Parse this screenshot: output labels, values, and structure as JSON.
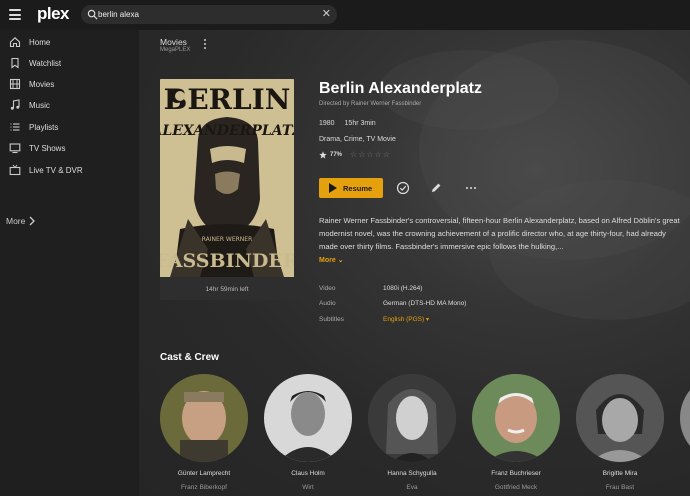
{
  "app": {
    "logo_text": "plex",
    "brand_color": "#e5a00d"
  },
  "search": {
    "value": "berlin alexa",
    "placeholder": "Search"
  },
  "sidebar": {
    "items": [
      {
        "label": "Home",
        "icon": "home-icon"
      },
      {
        "label": "Watchlist",
        "icon": "bookmark-icon"
      },
      {
        "label": "Movies",
        "icon": "film-icon"
      },
      {
        "label": "Music",
        "icon": "music-icon"
      },
      {
        "label": "Playlists",
        "icon": "list-icon"
      },
      {
        "label": "TV Shows",
        "icon": "tv-icon"
      },
      {
        "label": "Live TV & DVR",
        "icon": "broadcast-icon"
      }
    ],
    "more_label": "More"
  },
  "breadcrumb": {
    "title": "Movies",
    "subtitle": "MegaPLEX"
  },
  "movie": {
    "title": "Berlin Alexanderplatz",
    "director": "Directed by Rainer Werner Fassbinder",
    "year": "1980",
    "duration": "15hr 3min",
    "genres": "Drama, Crime, TV Movie",
    "rating_pct": "77%",
    "user_rating_stars": 0,
    "progress_remaining": "14hr 59min left",
    "poster_text": {
      "line1": "BERLIN",
      "line2": "ALEXANDERPLATZ",
      "line3": "FASSBINDER",
      "line4": "RAINER WERNER"
    },
    "resume_label": "Resume",
    "summary": "Rainer Werner Fassbinder's controversial, fifteen-hour Berlin Alexanderplatz, based on Alfred Döblin's great modernist novel, was the crowning achievement of a prolific director who, at age thirty-four, had already made over thirty films. Fassbinder's immersive epic follows the hulking,...",
    "more_label": "More",
    "info": {
      "video_label": "Video",
      "video_value": "1080i (H.264)",
      "audio_label": "Audio",
      "audio_value": "German (DTS-HD MA Mono)",
      "subtitles_label": "Subtitles",
      "subtitles_value": "English (PGS)"
    }
  },
  "cast": {
    "heading": "Cast & Crew",
    "members": [
      {
        "name": "Günter Lamprecht",
        "role": "Franz Biberkopf"
      },
      {
        "name": "Claus Holm",
        "role": "Wirt"
      },
      {
        "name": "Hanna Schygulla",
        "role": "Eva"
      },
      {
        "name": "Franz Buchrieser",
        "role": "Gottfried Meck"
      },
      {
        "name": "Brigitte Mira",
        "role": "Frau Bast"
      }
    ]
  }
}
